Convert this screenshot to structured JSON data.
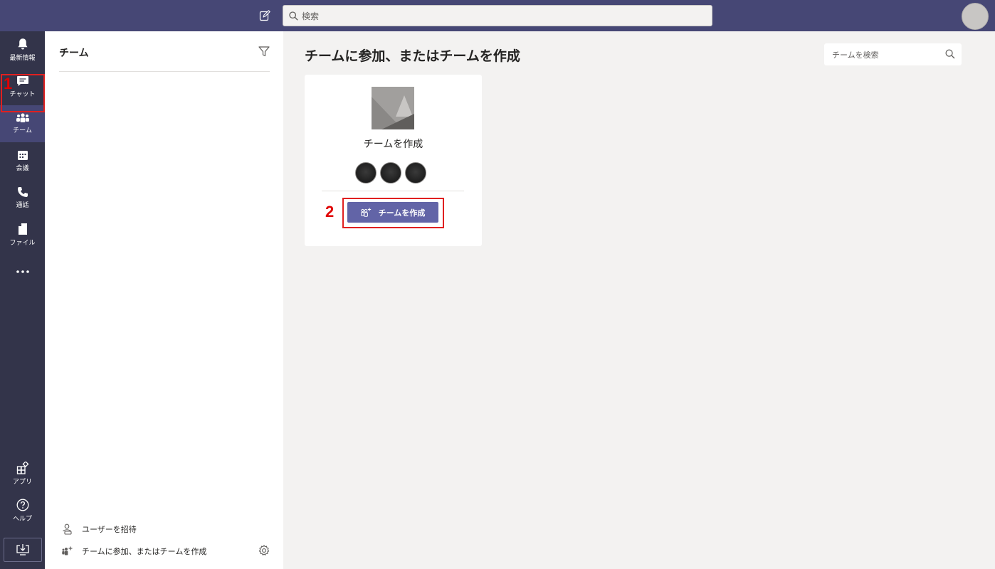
{
  "topbar": {
    "search_placeholder": "検索",
    "colors": {
      "background": "#464775"
    },
    "icons": {
      "compose": "compose-icon",
      "search": "search-icon"
    }
  },
  "rail": {
    "items": [
      {
        "id": "activity",
        "label": "最新情報",
        "icon": "bell-icon"
      },
      {
        "id": "chat",
        "label": "チャット",
        "icon": "chat-icon"
      },
      {
        "id": "teams",
        "label": "チーム",
        "icon": "teams-icon",
        "active": true
      },
      {
        "id": "calendar",
        "label": "会議",
        "icon": "calendar-icon"
      },
      {
        "id": "calls",
        "label": "通話",
        "icon": "phone-icon"
      },
      {
        "id": "files",
        "label": "ファイル",
        "icon": "file-icon"
      },
      {
        "id": "more",
        "label": "",
        "icon": "more-icon"
      }
    ],
    "bottom_items": [
      {
        "id": "apps",
        "label": "アプリ",
        "icon": "apps-icon"
      },
      {
        "id": "help",
        "label": "ヘルプ",
        "icon": "help-icon"
      },
      {
        "id": "download",
        "label": "",
        "icon": "download-icon"
      }
    ],
    "colors": {
      "background": "#33344a",
      "active": "#464775"
    }
  },
  "annotations": {
    "step1": "1",
    "step2": "2",
    "highlight_color": "#e02020"
  },
  "panel": {
    "title": "チーム",
    "invite_label": "ユーザーを招待",
    "join_create_label": "チームに参加、またはチームを作成"
  },
  "main": {
    "title": "チームに参加、またはチームを作成",
    "search_placeholder": "チームを検索",
    "card": {
      "title": "チームを作成",
      "button_label": "チームを作成",
      "member_count": 3
    },
    "colors": {
      "accent": "#6264a7"
    }
  }
}
